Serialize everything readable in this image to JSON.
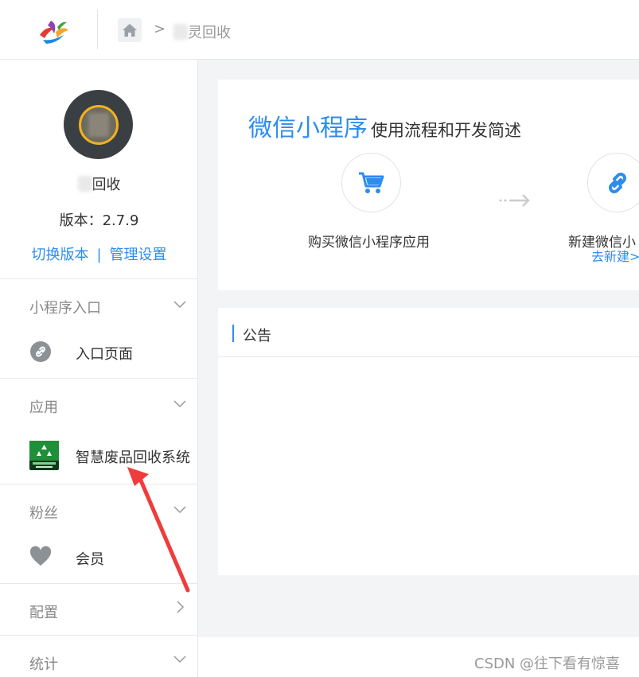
{
  "header": {
    "logo_icon": "app-logo",
    "home_icon": "home-icon",
    "breadcrumb_sep": ">",
    "breadcrumb_current": "灵回收"
  },
  "sidebar": {
    "app_name": "回收",
    "version": "版本：2.7.9",
    "switch_version": "切换版本",
    "link_sep": "|",
    "manage_settings": "管理设置",
    "sections": [
      {
        "title": "小程序入口",
        "items": [
          {
            "label": "入口页面",
            "icon": "link-icon"
          }
        ]
      },
      {
        "title": "应用",
        "items": [
          {
            "label": "智慧废品回收系统",
            "icon": "recycle-app-icon"
          }
        ]
      },
      {
        "title": "粉丝",
        "items": [
          {
            "label": "会员",
            "icon": "heart-icon"
          }
        ]
      },
      {
        "title": "配置",
        "items": []
      },
      {
        "title": "统计",
        "items": []
      }
    ]
  },
  "main": {
    "card1": {
      "title_big": "微信小程序",
      "title_small": "使用流程和开发简述",
      "steps": [
        {
          "label": "购买微信小程序应用",
          "icon": "cart-icon",
          "link": ""
        },
        {
          "label": "新建微信小",
          "icon": "link-icon",
          "link": "去新建>"
        }
      ]
    },
    "card2": {
      "title": "公告"
    }
  },
  "watermark": "CSDN @往下看有惊喜",
  "colors": {
    "accent": "#2d8cf0",
    "annotation": "#f03c3c"
  }
}
